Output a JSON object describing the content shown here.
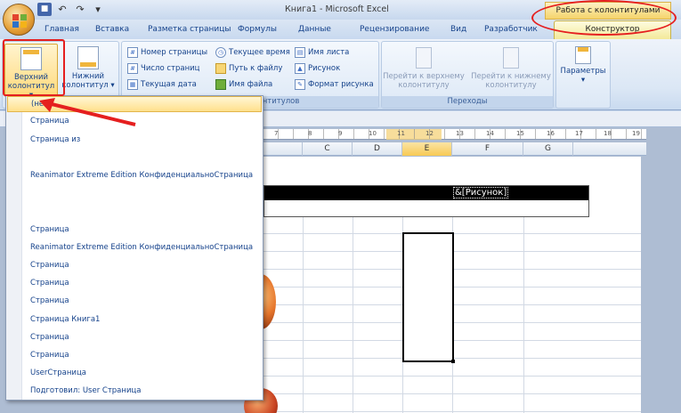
{
  "window": {
    "title": "Книга1 - Microsoft Excel",
    "context_tab_group": "Работа с колонтитулами"
  },
  "tabs": [
    "Главная",
    "Вставка",
    "Разметка страницы",
    "Формулы",
    "Данные",
    "Рецензирование",
    "Вид",
    "Разработчик"
  ],
  "active_tab": "Конструктор",
  "ribbon": {
    "header_button": "Верхний колонтитул",
    "footer_button": "Нижний колонтитул",
    "elements_group_label": "Элементы колонтитулов",
    "elements": {
      "page_number": "Номер страницы",
      "page_count": "Число страниц",
      "current_date": "Текущая дата",
      "current_time": "Текущее время",
      "file_path": "Путь к файлу",
      "file_name": "Имя файла",
      "sheet_name": "Имя листа",
      "picture": "Рисунок",
      "format_picture": "Формат рисунка"
    },
    "nav_group_label": "Переходы",
    "goto_header": "Перейти к верхнему колонтитулу",
    "goto_footer": "Перейти к нижнему колонтитулу",
    "options_button": "Параметры"
  },
  "dropdown": {
    "items": [
      "(нет)",
      "Страница",
      "Страница  из",
      "",
      "Reanimator Extreme Edition КонфиденциальноСтраница",
      "",
      "",
      "Страница",
      "Reanimator Extreme Edition КонфиденциальноСтраница",
      "Страница",
      "Страница",
      "Страница",
      "Страница Книга1",
      "Страница",
      "Страница",
      "UserСтраница",
      "Подготовил: User Страница"
    ]
  },
  "sheet": {
    "columns": [
      "C",
      "D",
      "E",
      "F",
      "G"
    ],
    "selected_column": "E",
    "ruler_numbers": [
      "7",
      "8",
      "9",
      "10",
      "11",
      "12",
      "13",
      "14",
      "15",
      "16",
      "17",
      "18",
      "19"
    ],
    "header_field": "&[Рисунок]"
  },
  "colors": {
    "annotation_red": "#e51f1f",
    "highlight_yellow": "#ffe08c"
  }
}
